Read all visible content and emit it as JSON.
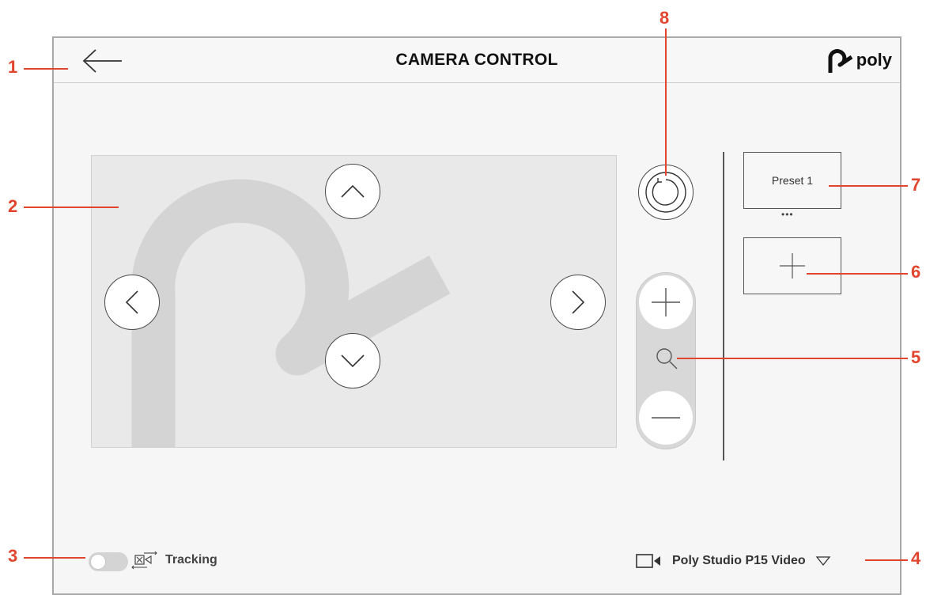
{
  "header": {
    "title": "CAMERA CONTROL",
    "back_icon": "arrow-left-icon",
    "logo_text": "poly",
    "logo_icon": "poly-logo-icon"
  },
  "viewport": {
    "pan_up_icon": "chevron-up-icon",
    "pan_down_icon": "chevron-down-icon",
    "pan_left_icon": "chevron-left-icon",
    "pan_right_icon": "chevron-right-icon",
    "watermark_icon": "poly-logo-watermark"
  },
  "controls": {
    "reset_icon": "rotate-ccw-icon",
    "zoom_in_icon": "plus-icon",
    "zoom_icon": "magnifier-icon",
    "zoom_out_icon": "minus-icon"
  },
  "presets": {
    "items": [
      {
        "label": "Preset 1"
      }
    ],
    "more_label": "•••",
    "add_icon": "plus-icon"
  },
  "footer": {
    "tracking_label": "Tracking",
    "tracking_on": false,
    "tracking_icon": "tracking-icon",
    "camera_icon": "video-camera-icon",
    "camera_name": "Poly Studio P15 Video",
    "dropdown_icon": "triangle-down-icon"
  },
  "callouts": [
    "1",
    "2",
    "3",
    "4",
    "5",
    "6",
    "7",
    "8"
  ],
  "colors": {
    "accent": "#e2452e",
    "frame": "#f5f6f5",
    "viewport": "#e9e9e9",
    "watermark": "#d4d4d4"
  }
}
